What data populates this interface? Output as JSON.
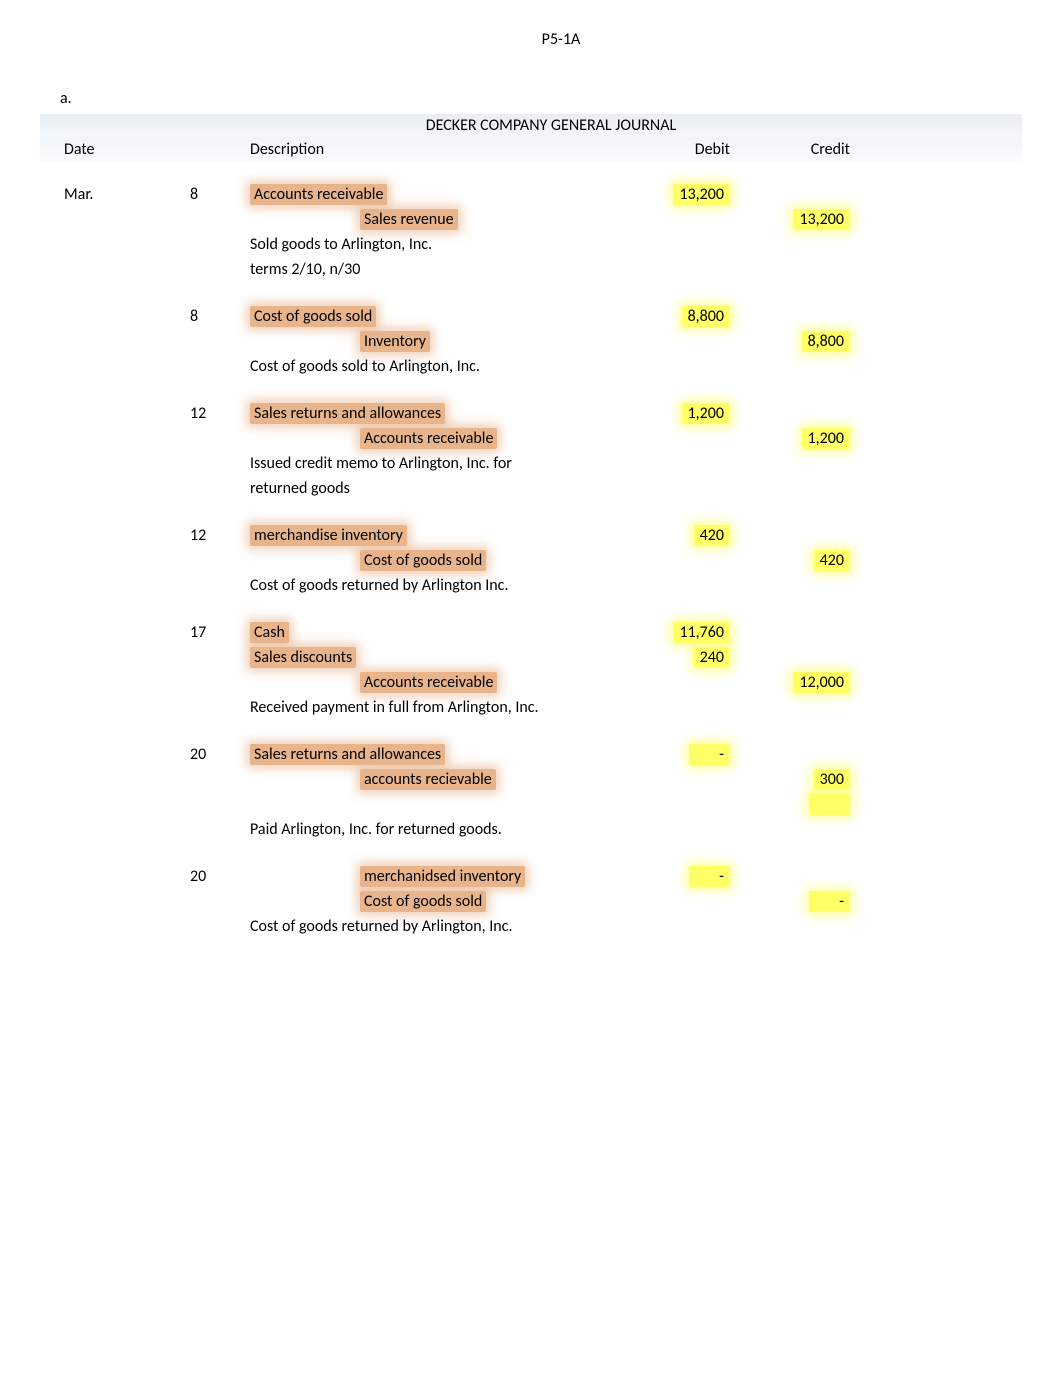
{
  "page_title": "P5-1A",
  "section_label": "a.",
  "journal_title": "DECKER COMPANY   GENERAL JOURNAL",
  "headers": {
    "date": "Date",
    "description": "Description",
    "debit": "Debit",
    "credit": "Credit"
  },
  "entries": [
    {
      "month": "Mar.",
      "day": "8",
      "lines": [
        {
          "text": "Accounts receivable",
          "hl": "orange",
          "indent": false,
          "debit": "13,200",
          "credit": ""
        },
        {
          "text": "Sales revenue",
          "hl": "orange",
          "indent": true,
          "debit": "",
          "credit": "13,200"
        },
        {
          "text": "Sold goods to Arlington, Inc.",
          "hl": "",
          "indent": false,
          "debit": "",
          "credit": ""
        },
        {
          "text": "terms 2/10, n/30",
          "hl": "",
          "indent": false,
          "debit": "",
          "credit": ""
        }
      ]
    },
    {
      "month": "",
      "day": "8",
      "lines": [
        {
          "text": "Cost of goods sold",
          "hl": "orange",
          "indent": false,
          "debit": "8,800",
          "credit": ""
        },
        {
          "text": "Inventory",
          "hl": "orange",
          "indent": true,
          "debit": "",
          "credit": "8,800"
        },
        {
          "text": "Cost of goods sold to Arlington, Inc.",
          "hl": "",
          "indent": false,
          "debit": "",
          "credit": ""
        }
      ]
    },
    {
      "month": "",
      "day": "12",
      "lines": [
        {
          "text": "Sales returns and allowances",
          "hl": "orange",
          "indent": false,
          "debit": "1,200",
          "credit": ""
        },
        {
          "text": "Accounts receivable",
          "hl": "orange",
          "indent": true,
          "debit": "",
          "credit": "1,200"
        },
        {
          "text": "Issued credit memo to Arlington, Inc. for",
          "hl": "",
          "indent": false,
          "debit": "",
          "credit": ""
        },
        {
          "text": "returned goods",
          "hl": "",
          "indent": false,
          "debit": "",
          "credit": ""
        }
      ]
    },
    {
      "month": "",
      "day": "12",
      "lines": [
        {
          "text": "merchandise inventory",
          "hl": "orange",
          "indent": false,
          "debit": "420",
          "credit": ""
        },
        {
          "text": "Cost of goods sold",
          "hl": "orange",
          "indent": true,
          "debit": "",
          "credit": "420"
        },
        {
          "text": "Cost of goods returned by Arlington Inc.",
          "hl": "",
          "indent": false,
          "debit": "",
          "credit": ""
        }
      ]
    },
    {
      "month": "",
      "day": "17",
      "lines": [
        {
          "text": "Cash",
          "hl": "orange",
          "indent": false,
          "debit": "11,760",
          "credit": ""
        },
        {
          "text": "Sales discounts",
          "hl": "orange",
          "indent": false,
          "debit": "240",
          "credit": ""
        },
        {
          "text": "Accounts receivable",
          "hl": "orange",
          "indent": true,
          "debit": "",
          "credit": "12,000"
        },
        {
          "text": "Received payment in full from Arlington, Inc.",
          "hl": "",
          "indent": false,
          "debit": "",
          "credit": ""
        }
      ]
    },
    {
      "month": "",
      "day": "20",
      "lines": [
        {
          "text": "Sales returns and allowances",
          "hl": "orange",
          "indent": false,
          "debit": "-",
          "credit": ""
        },
        {
          "text": "accounts recievable",
          "hl": "orange",
          "indent": true,
          "debit": "",
          "credit": "300"
        },
        {
          "text": "",
          "hl": "",
          "indent": false,
          "debit": "",
          "credit": "blank-yellow"
        },
        {
          "text": "Paid Arlington, Inc. for returned goods.",
          "hl": "",
          "indent": false,
          "debit": "",
          "credit": ""
        }
      ]
    },
    {
      "month": "",
      "day": "20",
      "lines": [
        {
          "text": "merchanidsed inventory",
          "hl": "orange",
          "indent": true,
          "debit": "-",
          "credit": ""
        },
        {
          "text": "Cost of goods sold",
          "hl": "orange",
          "indent": true,
          "debit": "",
          "credit": "-"
        },
        {
          "text": "Cost of goods returned by Arlington, Inc.",
          "hl": "",
          "indent": false,
          "debit": "",
          "credit": ""
        }
      ]
    }
  ]
}
